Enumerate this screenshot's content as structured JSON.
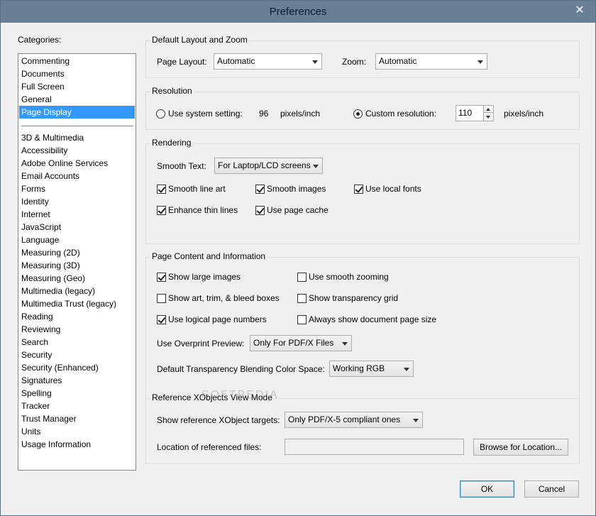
{
  "window": {
    "title": "Preferences",
    "close_symbol": "✕"
  },
  "categories": {
    "label": "Categories:",
    "top_items": [
      "Commenting",
      "Documents",
      "Full Screen",
      "General",
      "Page Display"
    ],
    "items": [
      "3D & Multimedia",
      "Accessibility",
      "Adobe Online Services",
      "Email Accounts",
      "Forms",
      "Identity",
      "Internet",
      "JavaScript",
      "Language",
      "Measuring (2D)",
      "Measuring (3D)",
      "Measuring (Geo)",
      "Multimedia (legacy)",
      "Multimedia Trust (legacy)",
      "Reading",
      "Reviewing",
      "Search",
      "Security",
      "Security (Enhanced)",
      "Signatures",
      "Spelling",
      "Tracker",
      "Trust Manager",
      "Units",
      "Usage Information"
    ],
    "selected": "Page Display"
  },
  "layout_zoom": {
    "title": "Default Layout and Zoom",
    "page_layout_label": "Page Layout:",
    "page_layout_value": "Automatic",
    "zoom_label": "Zoom:",
    "zoom_value": "Automatic"
  },
  "resolution": {
    "title": "Resolution",
    "system_label": "Use system setting:",
    "system_value": "96",
    "system_unit": "pixels/inch",
    "custom_label": "Custom resolution:",
    "custom_value": "110",
    "custom_unit": "pixels/inch",
    "selected": "custom"
  },
  "rendering": {
    "title": "Rendering",
    "smooth_text_label": "Smooth Text:",
    "smooth_text_value": "For Laptop/LCD screens",
    "smooth_line_art": {
      "label": "Smooth line art",
      "checked": true
    },
    "smooth_images": {
      "label": "Smooth images",
      "checked": true
    },
    "use_local_fonts": {
      "label": "Use local fonts",
      "checked": true
    },
    "enhance_thin_lines": {
      "label": "Enhance thin lines",
      "checked": true
    },
    "use_page_cache": {
      "label": "Use page cache",
      "checked": true
    }
  },
  "page_content": {
    "title": "Page Content and Information",
    "show_large_images": {
      "label": "Show large images",
      "checked": true
    },
    "use_smooth_zooming": {
      "label": "Use smooth zooming",
      "checked": false
    },
    "show_art_trim": {
      "label": "Show art, trim, & bleed boxes",
      "checked": false
    },
    "show_transparency_grid": {
      "label": "Show transparency grid",
      "checked": false
    },
    "use_logical_page_numbers": {
      "label": "Use logical page numbers",
      "checked": true
    },
    "always_show_page_size": {
      "label": "Always show document page size",
      "checked": false
    },
    "overprint_label": "Use Overprint Preview:",
    "overprint_value": "Only For PDF/X Files",
    "blending_label": "Default Transparency Blending Color Space:",
    "blending_value": "Working RGB"
  },
  "xobjects": {
    "title": "Reference XObjects View Mode",
    "targets_label": "Show reference XObject targets:",
    "targets_value": "Only PDF/X-5 compliant ones",
    "location_label": "Location of referenced files:",
    "location_value": "",
    "browse_label": "Browse for Location..."
  },
  "footer": {
    "ok_label": "OK",
    "cancel_label": "Cancel"
  },
  "watermark": "SOFTPEDIA"
}
